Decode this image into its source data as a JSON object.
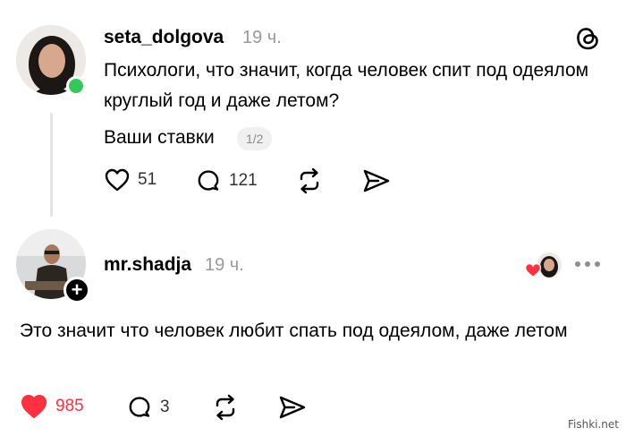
{
  "post": {
    "username": "seta_dolgova",
    "time": "19 ч.",
    "text": "Психологи, что значит, когда человек спит под одеялом круглый год и даже летом?",
    "subtext": "Ваши ставки",
    "page_indicator": "1/2",
    "likes": "51",
    "comments": "121"
  },
  "reply": {
    "username": "mr.shadja",
    "time": "19 ч.",
    "text": "Это значит что человек любит спать под одеялом, даже летом",
    "likes": "985",
    "comments": "3",
    "liked_color": "#ff3040"
  },
  "icons": {
    "app_logo": "threads-logo-icon",
    "like": "heart-icon",
    "comment": "comment-bubble-icon",
    "repost": "repost-icon",
    "share": "send-icon",
    "more": "more-dots-icon",
    "follow": "plus-icon"
  },
  "watermark": "Fishki.net"
}
